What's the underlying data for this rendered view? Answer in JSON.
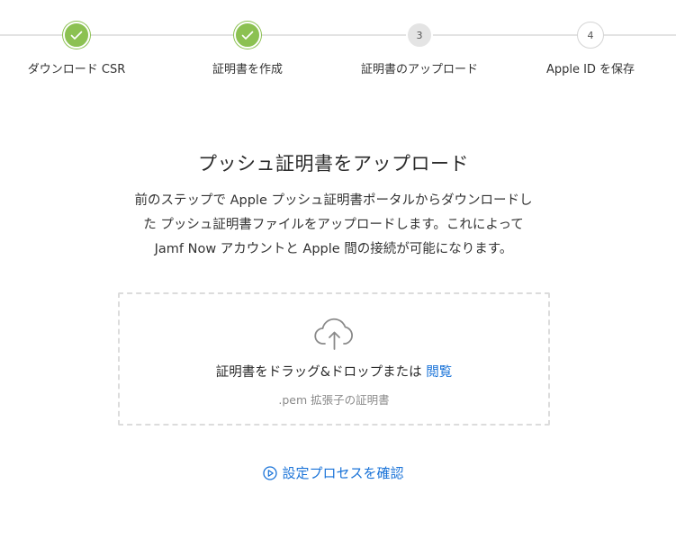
{
  "stepper": {
    "steps": [
      {
        "number": "1",
        "label": "ダウンロード CSR",
        "status": "completed",
        "icon": "check-icon"
      },
      {
        "number": "2",
        "label": "証明書を作成",
        "status": "completed",
        "icon": "check-icon"
      },
      {
        "number": "3",
        "label": "証明書のアップロード",
        "status": "current"
      },
      {
        "number": "4",
        "label": "Apple ID を保存",
        "status": "pending"
      }
    ],
    "colors": {
      "completed": "#8cc152",
      "current": "#e4e4e4",
      "line": "#e3e3e3"
    }
  },
  "main": {
    "title": "プッシュ証明書をアップロード",
    "description_lines": [
      "前のステップで Apple プッシュ証明書ポータルからダウンロードし",
      "た プッシュ証明書ファイルをアップロードします。これによって",
      "Jamf Now アカウントと Apple 間の接続が可能になります。"
    ]
  },
  "dropzone": {
    "icon": "cloud-upload-icon",
    "prompt": "証明書をドラッグ&ドロップまたは ",
    "browse_label": "閲覧",
    "hint": ".pem 拡張子の証明書"
  },
  "review": {
    "icon": "play-circle-icon",
    "label": "設定プロセスを確認"
  },
  "accent_color": "#1a73d8"
}
